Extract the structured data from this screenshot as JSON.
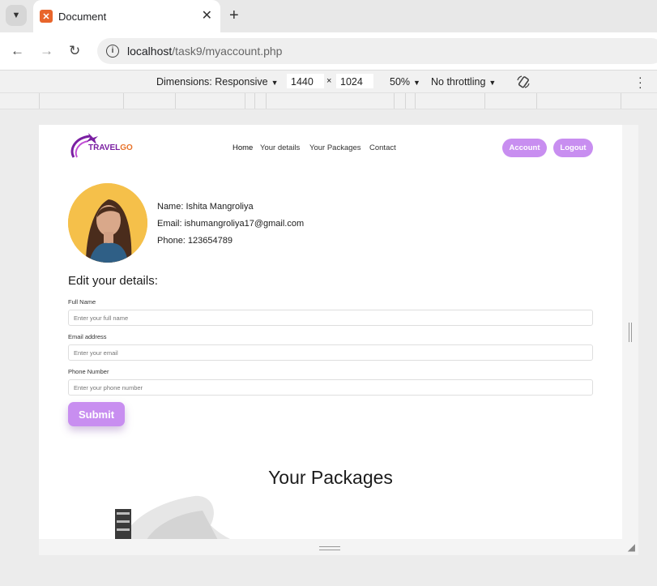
{
  "browser": {
    "tab_title": "Document",
    "url_host": "localhost",
    "url_path": "/task9/myaccount.php",
    "new_tab": "+",
    "tab_close": "✕"
  },
  "devtools": {
    "dimensions_label": "Dimensions: Responsive",
    "width": "1440",
    "height": "1024",
    "times": "×",
    "zoom": "50%",
    "throttling": "No throttling"
  },
  "site": {
    "logo": {
      "travel": "TRAVEL",
      "go": "GO"
    },
    "nav": [
      "Home",
      "Your details",
      "Your Packages",
      "Contact"
    ],
    "account_button": "Account",
    "logout_button": "Logout"
  },
  "profile": {
    "name": "Name: Ishita Mangroliya",
    "email": "Email: ishumangroliya17@gmail.com",
    "phone": "Phone: 123654789"
  },
  "edit_form": {
    "title": "Edit your details:",
    "fields": [
      {
        "label": "Full Name",
        "placeholder": "Enter your full name"
      },
      {
        "label": "Email address",
        "placeholder": "Enter your email"
      },
      {
        "label": "Phone Number",
        "placeholder": "Enter your phone number"
      }
    ],
    "submit_label": "Submit"
  },
  "packages": {
    "title": "Your Packages"
  },
  "colors": {
    "accent": "#c88ef0",
    "avatar_bg": "#f5c04a",
    "logo_purple": "#7a1fa2",
    "logo_orange": "#e8732a"
  },
  "icons": [
    "tab-list-icon",
    "favicon-icon",
    "close-icon",
    "plus-icon",
    "back-icon",
    "forward-icon",
    "reload-icon",
    "info-icon",
    "caret-down-icon",
    "rotate-icon",
    "more-vert-icon"
  ]
}
